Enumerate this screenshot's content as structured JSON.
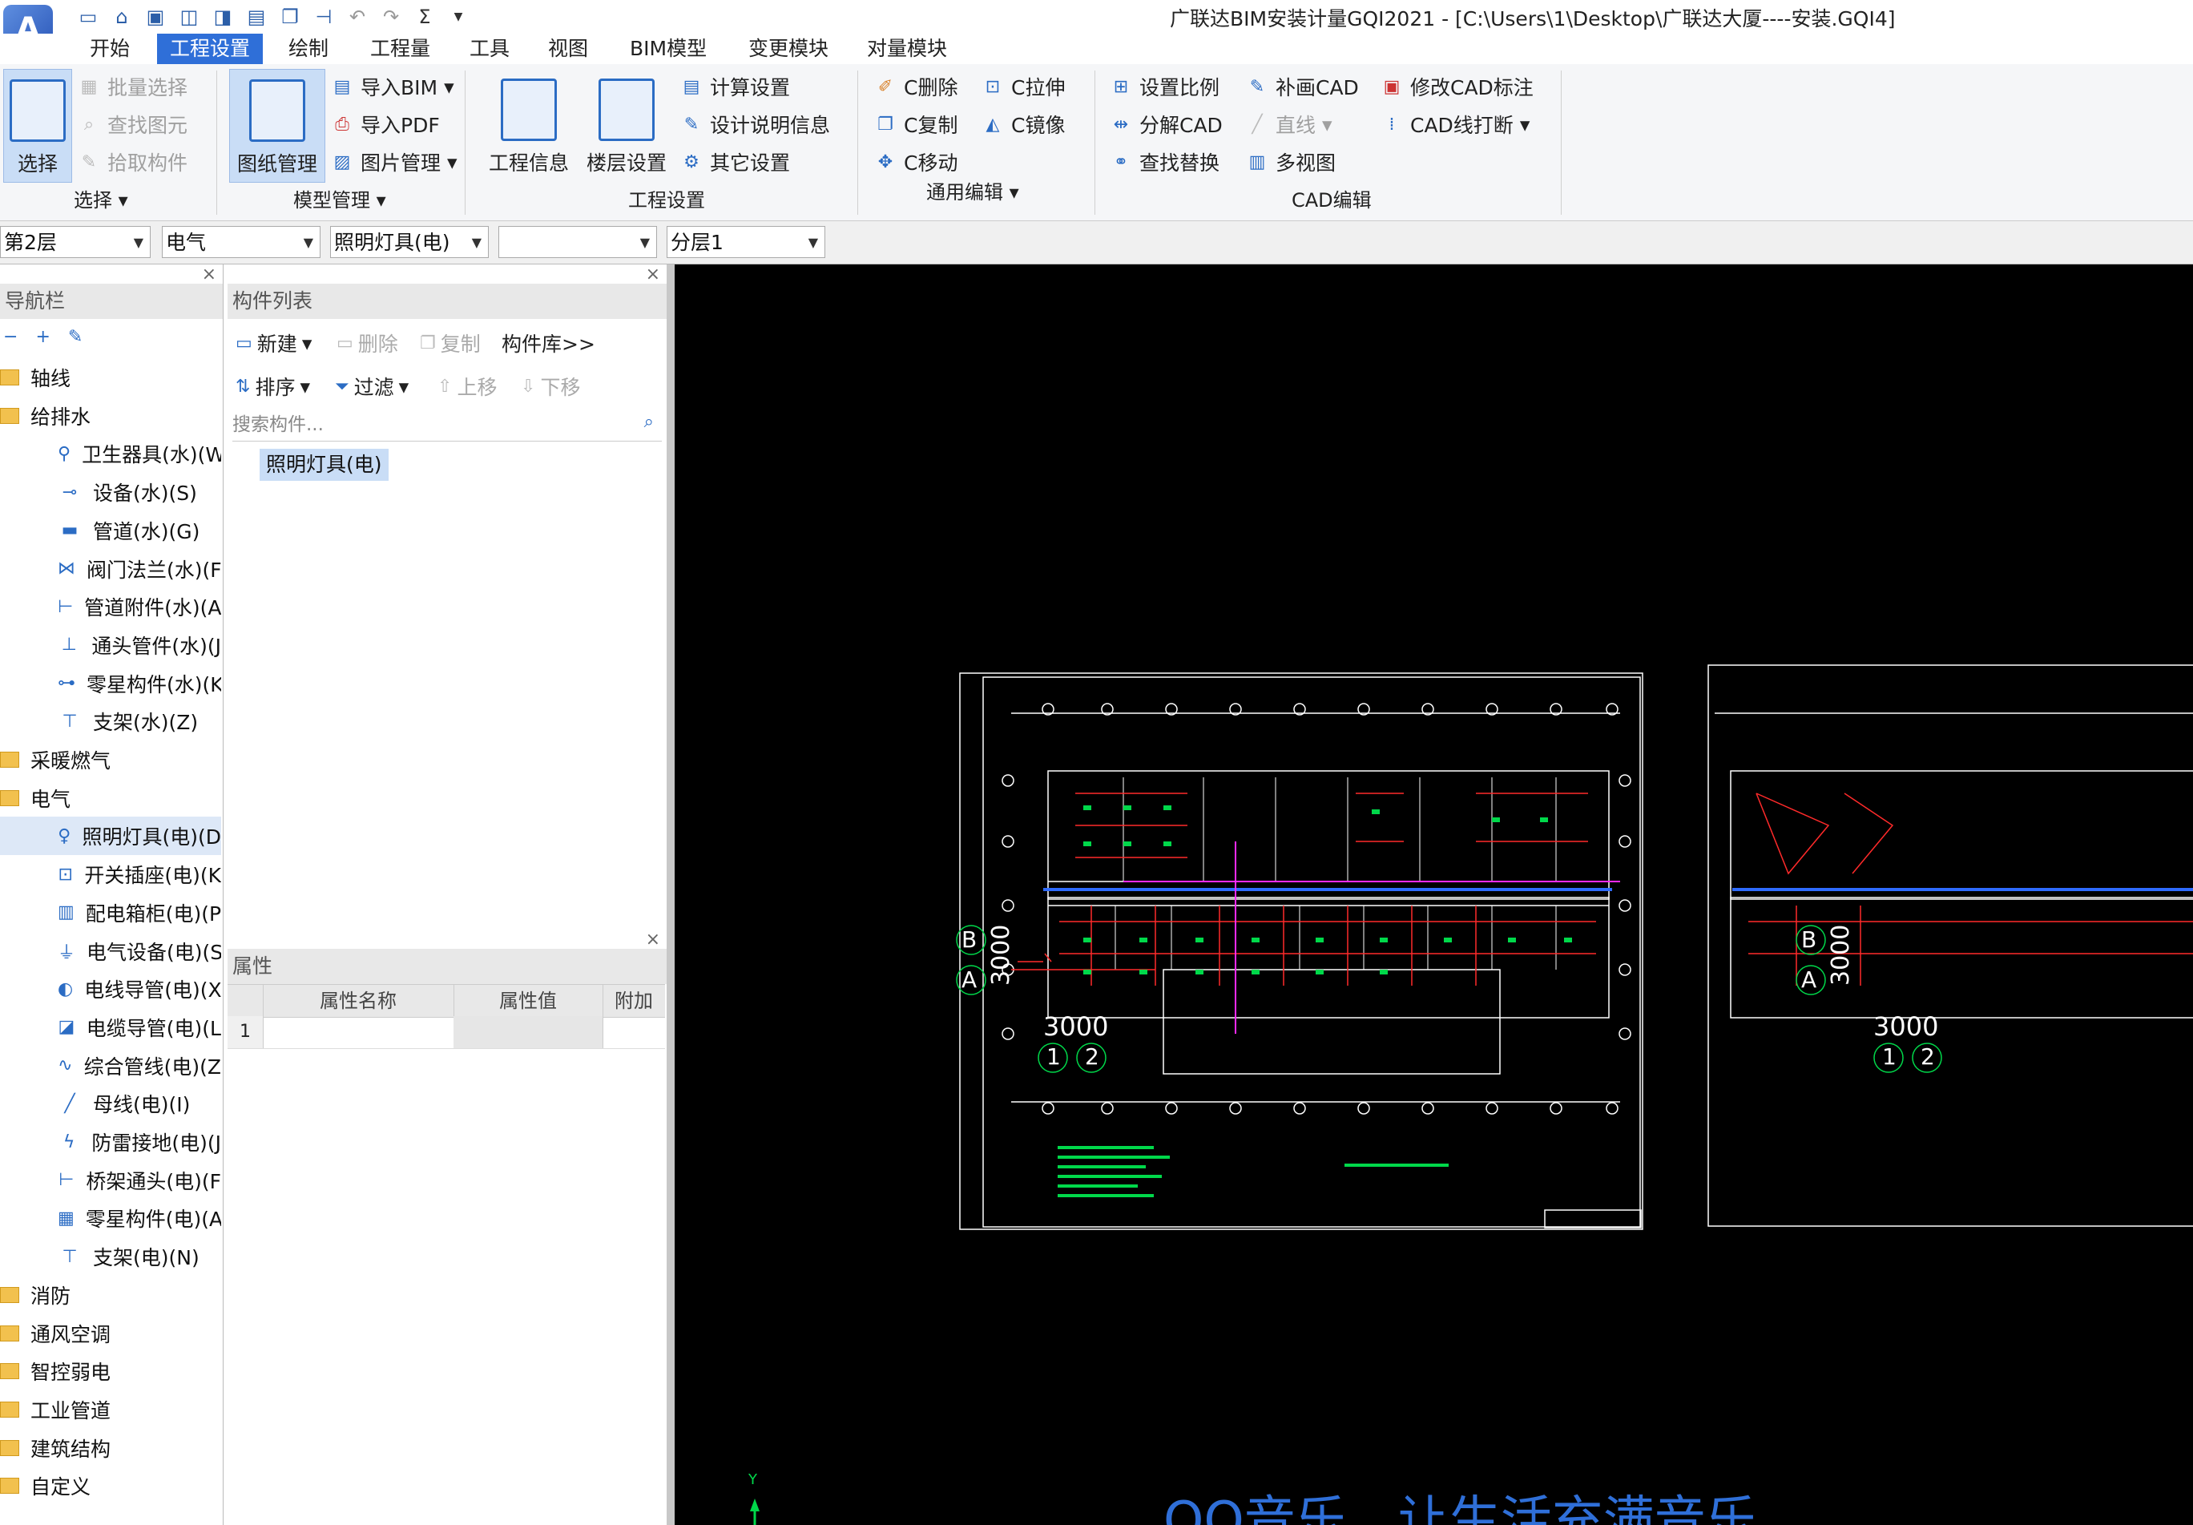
{
  "app": {
    "logo": "A",
    "title": "广联达BIM安装计量GQI2021 - [C:\\Users\\1\\Desktop\\广联达大厦----安装.GQI4]"
  },
  "quick_access": [
    "new-icon",
    "open-icon",
    "save-icon",
    "cad-icon",
    "export-icon",
    "report-icon",
    "copy-icon",
    "split-icon",
    "undo-icon",
    "redo-icon",
    "sum-icon",
    "dropdown-icon"
  ],
  "menu": {
    "tabs": [
      "开始",
      "工程设置",
      "绘制",
      "工程量",
      "工具",
      "视图",
      "BIM模型",
      "变更模块",
      "对量模块"
    ],
    "active": "工程设置"
  },
  "ribbon": {
    "select": {
      "big": "选择",
      "items": [
        "批量选择",
        "查找图元",
        "拾取构件"
      ],
      "label": "选择"
    },
    "model": {
      "big": "图纸管理",
      "items": [
        "导入BIM",
        "导入PDF",
        "图片管理"
      ],
      "label": "模型管理"
    },
    "project": {
      "big1": "工程信息",
      "big2": "楼层设置",
      "items": [
        "计算设置",
        "设计说明信息",
        "其它设置"
      ],
      "label": "工程设置"
    },
    "edit": {
      "items": [
        "C删除",
        "C复制",
        "C移动",
        "C拉伸",
        "C镜像"
      ],
      "label": "通用编辑"
    },
    "cad": {
      "items": [
        "设置比例",
        "分解CAD",
        "查找替换",
        "补画CAD",
        "直线",
        "多视图",
        "修改CAD标注",
        "CAD线打断"
      ],
      "label": "CAD编辑"
    }
  },
  "combos": [
    "第2层",
    "电气",
    "照明灯具(电)",
    "",
    "分层1"
  ],
  "nav": {
    "title": "导航栏",
    "tree": [
      {
        "type": "folder",
        "label": "轴线"
      },
      {
        "type": "folder",
        "label": "给排水"
      },
      {
        "type": "item",
        "label": "卫生器具(水)(W",
        "icon": "sink-icon"
      },
      {
        "type": "item",
        "label": "设备(水)(S)",
        "icon": "equipment-icon"
      },
      {
        "type": "item",
        "label": "管道(水)(G)",
        "icon": "pipe-icon"
      },
      {
        "type": "item",
        "label": "阀门法兰(水)(F",
        "icon": "valve-icon"
      },
      {
        "type": "item",
        "label": "管道附件(水)(A",
        "icon": "pipe-fitting-icon"
      },
      {
        "type": "item",
        "label": "通头管件(水)(J",
        "icon": "tee-icon"
      },
      {
        "type": "item",
        "label": "零星构件(水)(K",
        "icon": "misc-icon"
      },
      {
        "type": "item",
        "label": "支架(水)(Z)",
        "icon": "bracket-icon"
      },
      {
        "type": "folder",
        "label": "采暖燃气"
      },
      {
        "type": "folder",
        "label": "电气"
      },
      {
        "type": "item",
        "label": "照明灯具(电)(D",
        "icon": "lamp-icon",
        "selected": true
      },
      {
        "type": "item",
        "label": "开关插座(电)(K",
        "icon": "switch-icon"
      },
      {
        "type": "item",
        "label": "配电箱柜(电)(P",
        "icon": "cabinet-icon"
      },
      {
        "type": "item",
        "label": "电气设备(电)(S",
        "icon": "plug-icon"
      },
      {
        "type": "item",
        "label": "电线导管(电)(X",
        "icon": "conduit-icon"
      },
      {
        "type": "item",
        "label": "电缆导管(电)(L",
        "icon": "cable-icon"
      },
      {
        "type": "item",
        "label": "综合管线(电)(Z",
        "icon": "line-icon"
      },
      {
        "type": "item",
        "label": "母线(电)(I)",
        "icon": "busbar-icon"
      },
      {
        "type": "item",
        "label": "防雷接地(电)(J",
        "icon": "lightning-icon"
      },
      {
        "type": "item",
        "label": "桥架通头(电)(F",
        "icon": "tray-icon"
      },
      {
        "type": "item",
        "label": "零星构件(电)(A",
        "icon": "grid-icon"
      },
      {
        "type": "item",
        "label": "支架(电)(N)",
        "icon": "bracket-icon"
      },
      {
        "type": "folder",
        "label": "消防"
      },
      {
        "type": "folder",
        "label": "通风空调"
      },
      {
        "type": "folder",
        "label": "智控弱电"
      },
      {
        "type": "folder",
        "label": "工业管道"
      },
      {
        "type": "folder",
        "label": "建筑结构"
      },
      {
        "type": "folder",
        "label": "自定义"
      }
    ]
  },
  "component_list": {
    "title": "构件列表",
    "new": "新建",
    "delete": "删除",
    "copy": "复制",
    "library": "构件库>>",
    "sort": "排序",
    "filter": "过滤",
    "up": "上移",
    "down": "下移",
    "search_placeholder": "搜索构件...",
    "items": [
      "照明灯具(电)"
    ]
  },
  "properties": {
    "title": "属性",
    "columns": [
      "属性名称",
      "属性值",
      "附加"
    ],
    "rows": [
      "1"
    ]
  },
  "canvas": {
    "axis_labels": [
      "B",
      "A",
      "3000",
      "3000",
      "1",
      "2"
    ],
    "axis_labels2": [
      "B",
      "A",
      "3000",
      "3000",
      "1",
      "2"
    ],
    "axis_y": "Y",
    "overlay": "QQ音乐，让生活充满音乐"
  }
}
